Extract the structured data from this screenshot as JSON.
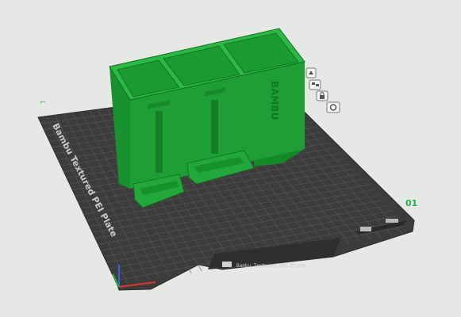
{
  "plate": {
    "name_label": "Bambu Textured PEI Plate",
    "plate_number": "01",
    "brand_marks": "BAMBU",
    "bottom_label": "Bambu Textured PEI Plate"
  },
  "model": {
    "embossed_text": "BAMBU"
  },
  "side_toolbar": {
    "icons": [
      "auto-orient-icon",
      "arrange-icon",
      "lock-icon",
      "settings-icon"
    ]
  },
  "colors": {
    "background": "#e6e8e5",
    "plate": "#3c3c3c",
    "grid": "#5a5a5a",
    "model_face": "#1f9e35",
    "model_side": "#138a28",
    "model_top": "#2cb845",
    "plate_number": "#1fb441"
  },
  "axes": {
    "x_color": "#e03030",
    "y_color": "#30b030",
    "z_color": "#3060e0"
  }
}
